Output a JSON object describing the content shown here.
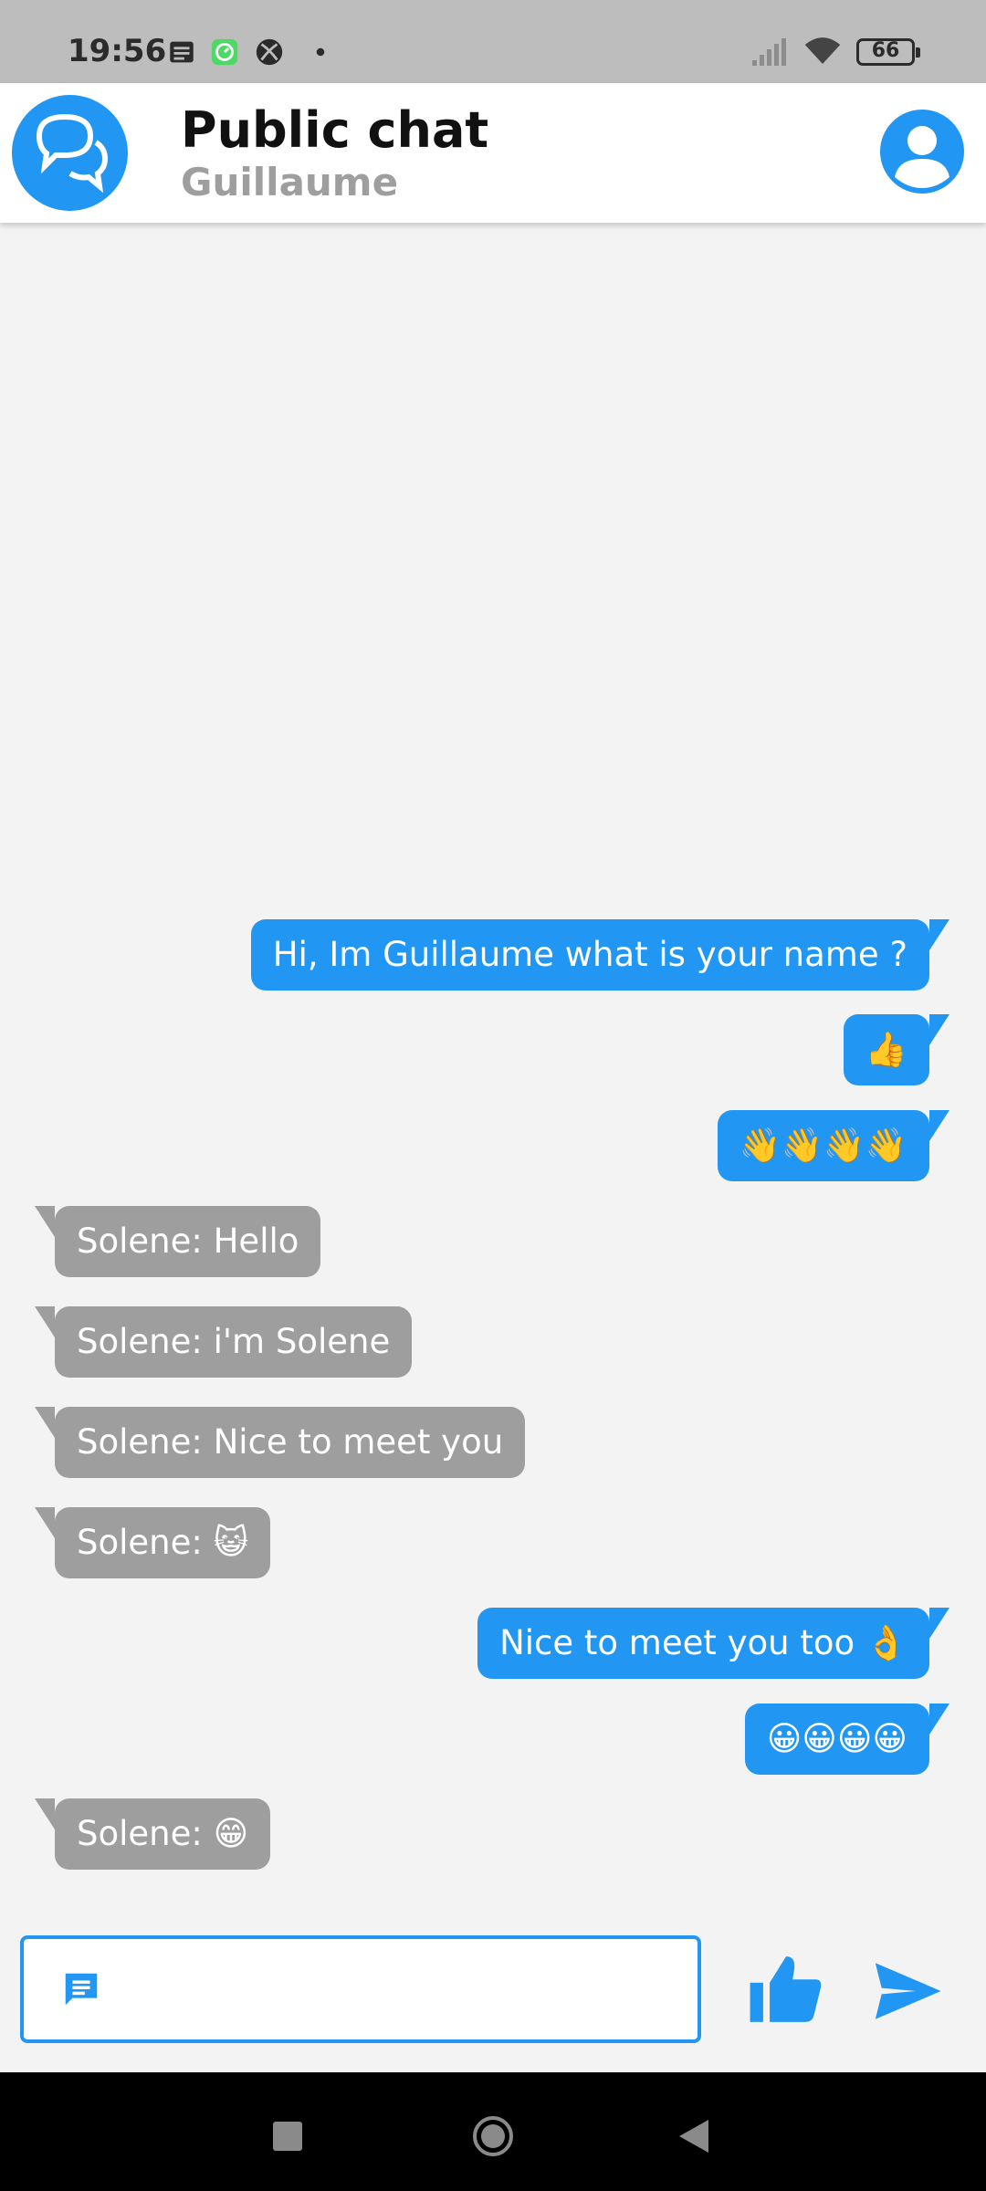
{
  "status_bar": {
    "time": "19:56",
    "battery": "66",
    "icons": [
      "notes-icon",
      "clock-app-icon",
      "xbox-icon",
      "dot-icon",
      "signal-icon",
      "wifi-icon",
      "battery-icon"
    ]
  },
  "header": {
    "title": "Public chat",
    "subtitle": "Guillaume",
    "logo_icon": "chat-bubbles-icon",
    "profile_icon": "account-circle-icon"
  },
  "messages": [
    {
      "from": "me",
      "text": "Hi, Im Guillaume what is your name ?"
    },
    {
      "from": "me",
      "text": "👍"
    },
    {
      "from": "me",
      "text": "👋👋👋👋"
    },
    {
      "from": "other",
      "text": "Solene: Hello"
    },
    {
      "from": "other",
      "text": "Solene: i'm Solene"
    },
    {
      "from": "other",
      "text": "Solene: Nice to meet you"
    },
    {
      "from": "other",
      "text": "Solene: 😺"
    },
    {
      "from": "me",
      "text": "Nice to meet you too 👌"
    },
    {
      "from": "me",
      "text": "😀😀😀😀"
    },
    {
      "from": "other",
      "text": "Solene: 😁"
    }
  ],
  "composer": {
    "value": "",
    "placeholder": "",
    "message_icon": "message-icon",
    "like_icon": "thumb-up-icon",
    "send_icon": "send-icon"
  },
  "colors": {
    "accent": "#2196f3",
    "other_bubble": "#9e9e9e",
    "background": "#f3f3f3"
  },
  "nav_bar": {
    "icons": [
      "recents-square-icon",
      "home-circle-icon",
      "back-triangle-icon"
    ]
  }
}
